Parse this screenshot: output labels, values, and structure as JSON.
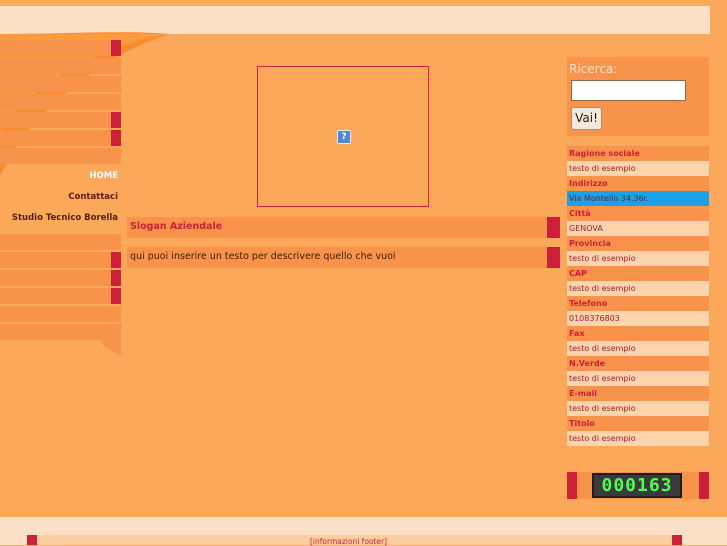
{
  "nav": {
    "items": [
      {
        "label": "HOME"
      },
      {
        "label": "Contattaci"
      },
      {
        "label": "Studio Tecnico Borella"
      }
    ]
  },
  "main": {
    "slogan": "Slogan Aziendale",
    "description": "qui puoi inserire un testo per descrivere quello che vuoi",
    "image_placeholder_glyph": "?"
  },
  "search": {
    "title": "Ricerca:",
    "input_value": "",
    "button_label": "Vai!"
  },
  "info": [
    {
      "label": "Ragione sociale",
      "value": "testo di esempio"
    },
    {
      "label": "Indirizzo",
      "value": "Via Montello 34,36r."
    },
    {
      "label": "Città",
      "value": "GENOVA"
    },
    {
      "label": "Provincia",
      "value": "testo di esempio"
    },
    {
      "label": "CAP",
      "value": "testo di esempio"
    },
    {
      "label": "Telefono",
      "value": "0108376803"
    },
    {
      "label": "Fax",
      "value": "testo di esempio"
    },
    {
      "label": "N.Verde",
      "value": "testo di esempio"
    },
    {
      "label": "E-mail",
      "value": "testo di esempio"
    },
    {
      "label": "Titolo",
      "value": "testo di esempio"
    }
  ],
  "counter": {
    "value": "000163"
  },
  "footer": {
    "text": "[informazioni footer]"
  },
  "colors": {
    "accent": "#cc1f3a",
    "panel": "#f7934a",
    "background": "#fba85a",
    "light": "#fde1c6"
  }
}
